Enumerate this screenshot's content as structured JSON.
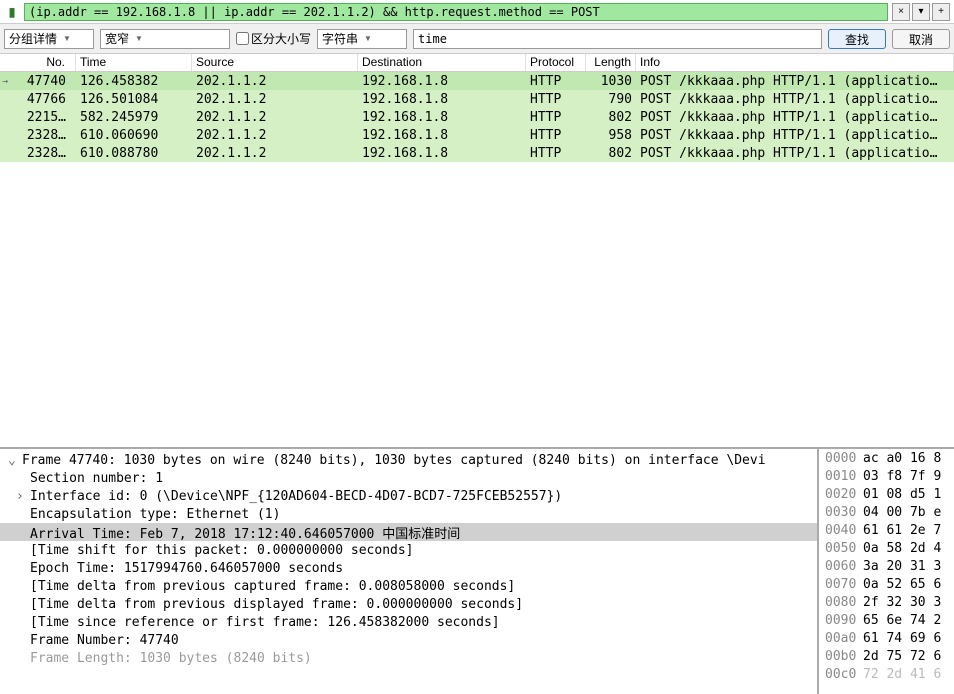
{
  "filter": {
    "expression": "(ip.addr == 192.168.1.8 || ip.addr == 202.1.1.2) && http.request.method == POST",
    "close_label": "×",
    "dropdown_label": "▾",
    "plus_label": "+"
  },
  "search": {
    "group_label": "分组详情",
    "width_label": "宽窄",
    "case_label": "区分大小写",
    "string_label": "字符串",
    "search_value": "time",
    "find_label": "查找",
    "cancel_label": "取消"
  },
  "columns": {
    "no": "No.",
    "time": "Time",
    "source": "Source",
    "destination": "Destination",
    "protocol": "Protocol",
    "length": "Length",
    "info": "Info"
  },
  "packets": [
    {
      "no": "47740",
      "time": "126.458382",
      "src": "202.1.1.2",
      "dst": "192.168.1.8",
      "proto": "HTTP",
      "len": "1030",
      "info": "POST /kkkaaa.php HTTP/1.1  (applicatio…",
      "selected": true,
      "arrow": true
    },
    {
      "no": "47766",
      "time": "126.501084",
      "src": "202.1.1.2",
      "dst": "192.168.1.8",
      "proto": "HTTP",
      "len": "790",
      "info": "POST /kkkaaa.php HTTP/1.1  (applicatio…"
    },
    {
      "no": "2215…",
      "time": "582.245979",
      "src": "202.1.1.2",
      "dst": "192.168.1.8",
      "proto": "HTTP",
      "len": "802",
      "info": "POST /kkkaaa.php HTTP/1.1  (applicatio…"
    },
    {
      "no": "2328…",
      "time": "610.060690",
      "src": "202.1.1.2",
      "dst": "192.168.1.8",
      "proto": "HTTP",
      "len": "958",
      "info": "POST /kkkaaa.php HTTP/1.1  (applicatio…"
    },
    {
      "no": "2328…",
      "time": "610.088780",
      "src": "202.1.1.2",
      "dst": "192.168.1.8",
      "proto": "HTTP",
      "len": "802",
      "info": "POST /kkkaaa.php HTTP/1.1  (applicatio…"
    }
  ],
  "tree": {
    "frame_summary": "Frame 47740: 1030 bytes on wire (8240 bits), 1030 bytes captured (8240 bits) on interface \\Devi",
    "section": "Section number: 1",
    "iface": "Interface id: 0 (\\Device\\NPF_{120AD604-BECD-4D07-BCD7-725FCEB52557})",
    "encap": "Encapsulation type: Ethernet (1)",
    "arrival": "Arrival Time: Feb  7, 2018 17:12:40.646057000 中国标准时间",
    "tshift": "[Time shift for this packet: 0.000000000 seconds]",
    "epoch": "Epoch Time: 1517994760.646057000 seconds",
    "delta_cap": "[Time delta from previous captured frame: 0.008058000 seconds]",
    "delta_disp": "[Time delta from previous displayed frame: 0.000000000 seconds]",
    "since_ref": "[Time since reference or first frame: 126.458382000 seconds]",
    "frame_num": "Frame Number: 47740",
    "frame_len": "Frame Length: 1030 bytes (8240 bits)"
  },
  "hex": [
    {
      "off": "0000",
      "b": "ac a0 16 8"
    },
    {
      "off": "0010",
      "b": "03 f8 7f 9"
    },
    {
      "off": "0020",
      "b": "01 08 d5 1"
    },
    {
      "off": "0030",
      "b": "04 00 7b e"
    },
    {
      "off": "0040",
      "b": "61 61 2e 7"
    },
    {
      "off": "0050",
      "b": "0a 58 2d 4"
    },
    {
      "off": "0060",
      "b": "3a 20 31 3"
    },
    {
      "off": "0070",
      "b": "0a 52 65 6"
    },
    {
      "off": "0080",
      "b": "2f 32 30 3"
    },
    {
      "off": "0090",
      "b": "65 6e 74 2"
    },
    {
      "off": "00a0",
      "b": "61 74 69 6"
    },
    {
      "off": "00b0",
      "b": "2d 75 72 6"
    },
    {
      "off": "00c0",
      "b": "72 2d 41 6"
    }
  ]
}
